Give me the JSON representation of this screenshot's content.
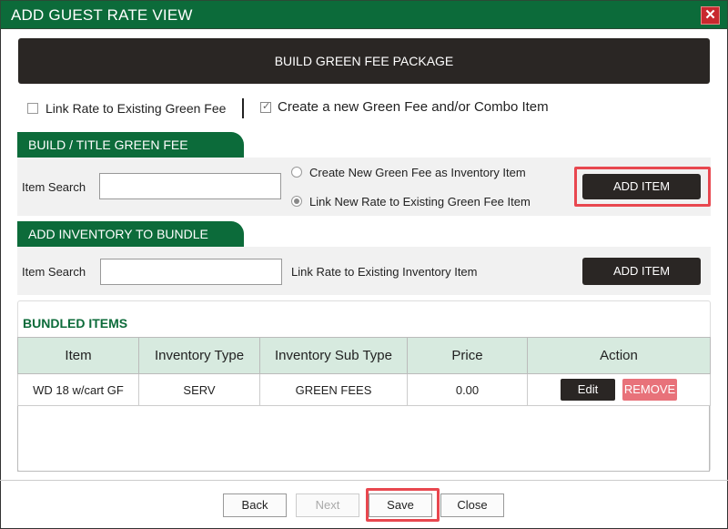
{
  "window": {
    "title": "ADD GUEST RATE VIEW",
    "close_label": "✕"
  },
  "banner": {
    "label": "BUILD GREEN FEE PACKAGE"
  },
  "options": {
    "link_rate": {
      "label": "Link Rate to Existing Green Fee",
      "checked": false
    },
    "create_new": {
      "label": "Create a new Green Fee and/or Combo Item",
      "checked": true
    }
  },
  "build_section": {
    "title": "BUILD / TITLE GREEN FEE",
    "search_label": "Item Search",
    "search_value": "",
    "radio_create": {
      "label": "Create New Green Fee as Inventory Item",
      "selected": false
    },
    "radio_link": {
      "label": "Link New Rate to Existing Green Fee Item",
      "selected": true
    },
    "add_button": "ADD ITEM"
  },
  "inventory_section": {
    "title": "ADD INVENTORY TO BUNDLE",
    "search_label": "Item Search",
    "search_value": "",
    "link_label": "Link Rate to Existing Inventory Item",
    "add_button": "ADD ITEM"
  },
  "bundled": {
    "title": "BUNDLED ITEMS",
    "columns": [
      "Item",
      "Inventory Type",
      "Inventory Sub Type",
      "Price",
      "Action"
    ],
    "rows": [
      {
        "item": "WD 18 w/cart GF",
        "type": "SERV",
        "subtype": "GREEN FEES",
        "price": "0.00",
        "edit": "Edit",
        "remove": "REMOVE"
      }
    ]
  },
  "footer": {
    "back": "Back",
    "next": "Next",
    "save": "Save",
    "close": "Close"
  },
  "colors": {
    "brand_green": "#0c6b3a",
    "dark": "#2a2624",
    "highlight": "#e8474f",
    "remove": "#e8727a"
  }
}
